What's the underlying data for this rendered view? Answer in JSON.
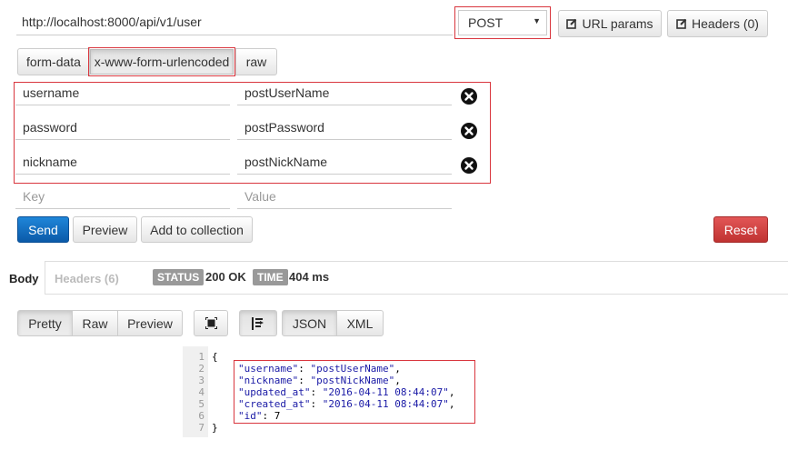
{
  "request": {
    "url": "http://localhost:8000/api/v1/user",
    "method": "POST",
    "url_params_label": "URL params",
    "headers_label": "Headers (0)"
  },
  "body_tabs": {
    "form_data": "form-data",
    "urlencoded": "x-www-form-urlencoded",
    "raw": "raw",
    "active": "x-www-form-urlencoded"
  },
  "params": [
    {
      "key": "username",
      "value": "postUserName"
    },
    {
      "key": "password",
      "value": "postPassword"
    },
    {
      "key": "nickname",
      "value": "postNickName"
    }
  ],
  "new_param": {
    "key_placeholder": "Key",
    "value_placeholder": "Value"
  },
  "actions": {
    "send": "Send",
    "preview": "Preview",
    "add_to_collection": "Add to collection",
    "reset": "Reset"
  },
  "response": {
    "tab_body": "Body",
    "tab_headers": "Headers (6)",
    "status_label": "STATUS",
    "status_value": "200 OK",
    "time_label": "TIME",
    "time_value": "404 ms",
    "view_modes": {
      "pretty": "Pretty",
      "raw": "Raw",
      "preview": "Preview"
    },
    "formats": {
      "json": "JSON",
      "xml": "XML"
    },
    "line_numbers": [
      "1",
      "2",
      "3",
      "4",
      "5",
      "6",
      "7"
    ],
    "code": {
      "open": "{",
      "close": "}",
      "lines": [
        {
          "key": "\"username\"",
          "value": "\"postUserName\"",
          "tail": ","
        },
        {
          "key": "\"nickname\"",
          "value": "\"postNickName\"",
          "tail": ","
        },
        {
          "key": "\"updated_at\"",
          "value": "\"2016-04-11 08:44:07\"",
          "tail": ","
        },
        {
          "key": "\"created_at\"",
          "value": "\"2016-04-11 08:44:07\"",
          "tail": ","
        },
        {
          "key": "\"id\"",
          "value": "7",
          "tail": ""
        }
      ]
    }
  },
  "colors": {
    "highlight_outline": "#d9363e",
    "send_button": "#0b5aa8",
    "reset_button": "#c03332",
    "badge": "#999999",
    "json_string": "#1a1aa6"
  },
  "icons": {
    "edit": "pencil-square-icon",
    "delete": "circle-x-icon",
    "fullscreen": "fullscreen-icon",
    "wrap": "word-wrap-icon",
    "dropdown": "caret-down-icon"
  }
}
